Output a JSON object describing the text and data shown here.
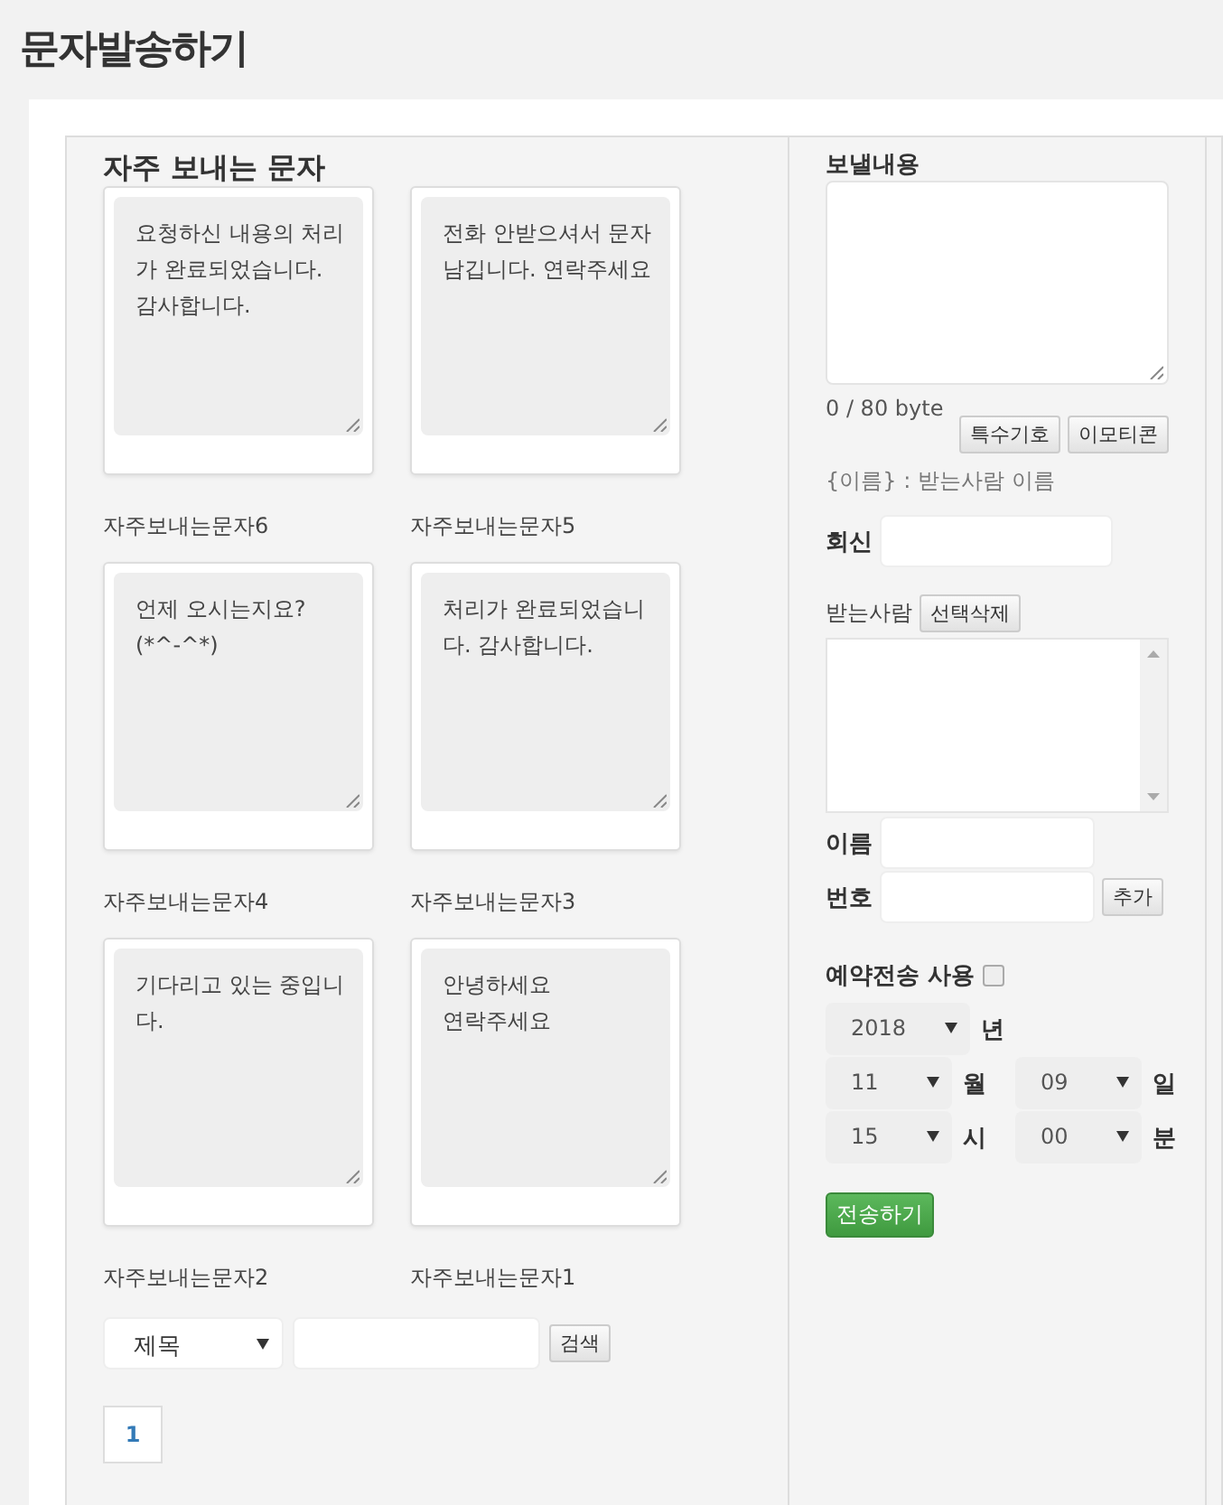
{
  "page_title": "문자발송하기",
  "templates_heading": "자주 보내는 문자",
  "templates": [
    {
      "text": "요청하신 내용의 처리가 완료되었습니다.\n감사합니다.",
      "label": "자주보내는문자6"
    },
    {
      "text": "전화 안받으셔서 문자 남깁니다. 연락주세요",
      "label": "자주보내는문자5"
    },
    {
      "text": "언제 오시는지요?\n(*^-^*)",
      "label": "자주보내는문자4"
    },
    {
      "text": "처리가 완료되었습니다. 감사합니다.",
      "label": "자주보내는문자3"
    },
    {
      "text": "기다리고 있는 중입니다.",
      "label": "자주보내는문자2"
    },
    {
      "text": "안녕하세요\n연락주세요",
      "label": "자주보내는문자1"
    }
  ],
  "search": {
    "select_value": "제목",
    "button": "검색"
  },
  "pagination": [
    "1"
  ],
  "compose": {
    "heading": "보낼내용",
    "byte_count": "0 / 80 byte",
    "buttons": [
      "특수기호",
      "이모티콘"
    ],
    "hint": "{이름} : 받는사람 이름",
    "reply_label": "회신",
    "recipients_label": "받는사람",
    "recipients_button": "선택삭제",
    "name_label": "이름",
    "number_label": "번호",
    "number_button": "추가",
    "reservation": {
      "label": "예약전송 사용",
      "checked": false
    },
    "date_rows": [
      [
        {
          "value": "2018",
          "unit": "년"
        }
      ],
      [
        {
          "value": "11",
          "unit": "월"
        },
        {
          "value": "09",
          "unit": "일"
        }
      ],
      [
        {
          "value": "15",
          "unit": "시"
        },
        {
          "value": "00",
          "unit": "분"
        }
      ]
    ],
    "send_button": "전송하기"
  }
}
